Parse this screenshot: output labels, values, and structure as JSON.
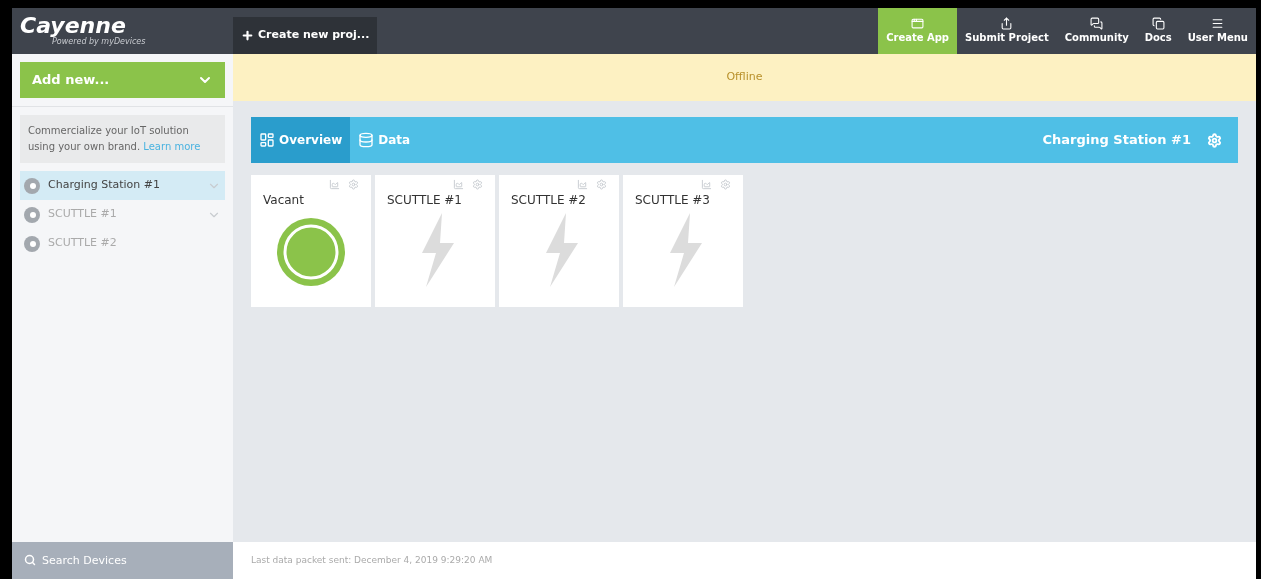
{
  "brand": {
    "name": "Cayenne",
    "tagline": "Powered by myDevices"
  },
  "create_project": "Create new proj...",
  "nav": [
    {
      "label": "Create App",
      "selected": true
    },
    {
      "label": "Submit Project",
      "selected": false
    },
    {
      "label": "Community",
      "selected": false
    },
    {
      "label": "Docs",
      "selected": false
    },
    {
      "label": "User Menu",
      "selected": false
    }
  ],
  "add_new": "Add new...",
  "promo": {
    "text": "Commercialize your IoT solution using your own brand.",
    "link": "Learn more"
  },
  "devices": [
    {
      "name": "Charging Station #1",
      "selected": true,
      "expandable": true
    },
    {
      "name": "SCUTTLE #1",
      "selected": false,
      "expandable": true
    },
    {
      "name": "SCUTTLE #2",
      "selected": false,
      "expandable": false
    }
  ],
  "search": {
    "placeholder": "Search Devices"
  },
  "status_banner": "Offline",
  "tabs": [
    {
      "label": "Overview",
      "selected": true
    },
    {
      "label": "Data",
      "selected": false
    }
  ],
  "device_title": "Charging Station #1",
  "widgets": [
    {
      "title": "Vacant",
      "kind": "status"
    },
    {
      "title": "SCUTTLE #1",
      "kind": "power"
    },
    {
      "title": "SCUTTLE #2",
      "kind": "power"
    },
    {
      "title": "SCUTTLE #3",
      "kind": "power"
    }
  ],
  "status_bar": "Last data packet sent: December 4, 2019 9:29:20 AM"
}
